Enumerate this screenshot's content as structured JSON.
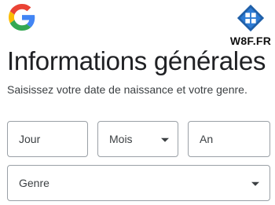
{
  "logo": {
    "brand_icon": "google-g-icon",
    "brand_colors": [
      "#4285F4",
      "#EA4335",
      "#FBBC05",
      "#34A853"
    ]
  },
  "watermark": {
    "icon": "windows-logo-icon",
    "text": "W8F.FR"
  },
  "header": {
    "title": "Informations générales",
    "subtitle": "Saisissez votre date de naissance et votre genre."
  },
  "form": {
    "day": {
      "label": "Jour"
    },
    "month": {
      "label": "Mois",
      "icon": "dropdown-caret-icon"
    },
    "year": {
      "label": "An"
    },
    "gender": {
      "label": "Genre",
      "icon": "dropdown-caret-icon"
    }
  }
}
